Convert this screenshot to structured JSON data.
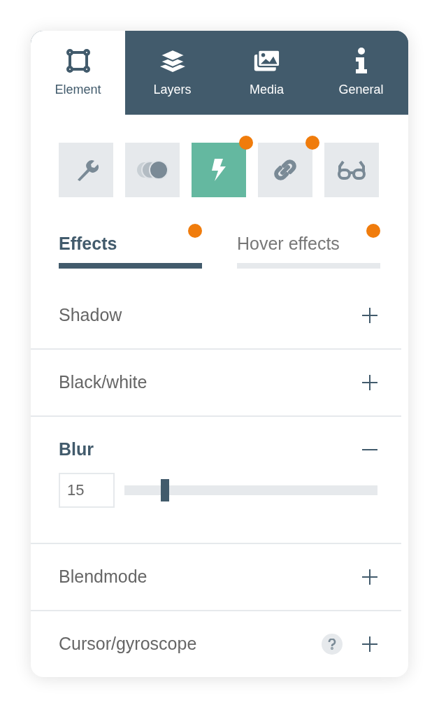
{
  "tabs": [
    {
      "label": "Element",
      "kind": "frame",
      "selected": true
    },
    {
      "label": "Layers",
      "kind": "layers",
      "selected": false
    },
    {
      "label": "Media",
      "kind": "images",
      "selected": false
    },
    {
      "label": "General",
      "kind": "info",
      "selected": false
    }
  ],
  "tools": [
    {
      "kind": "wrench",
      "selected": false,
      "marked": false
    },
    {
      "kind": "circles",
      "selected": false,
      "marked": false
    },
    {
      "kind": "bolt",
      "selected": true,
      "marked": true
    },
    {
      "kind": "chain",
      "selected": false,
      "marked": true
    },
    {
      "kind": "glasses",
      "selected": false,
      "marked": false
    }
  ],
  "subtabs": [
    {
      "label": "Effects",
      "selected": true,
      "marked": true
    },
    {
      "label": "Hover effects",
      "selected": false,
      "marked": true
    }
  ],
  "sections": [
    {
      "label": "Shadow",
      "expanded": false
    },
    {
      "label": "Black/white",
      "expanded": false
    },
    {
      "label": "Blur",
      "expanded": true,
      "value": "15",
      "level": 0.16
    },
    {
      "label": "Blendmode",
      "expanded": false
    },
    {
      "label": "Cursor/gyroscope",
      "expanded": false,
      "help": true
    }
  ]
}
